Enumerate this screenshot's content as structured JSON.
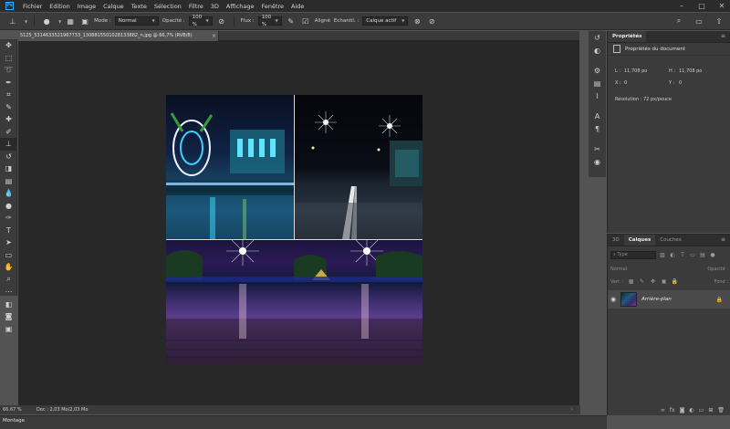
{
  "menubar": {
    "app_icon": "Ps",
    "items": [
      "Fichier",
      "Edition",
      "Image",
      "Calque",
      "Texte",
      "Sélection",
      "Filtre",
      "3D",
      "Affichage",
      "Fenêtre",
      "Aide"
    ]
  },
  "options": {
    "mode_label": "Mode :",
    "mode_value": "Normal",
    "opacity_label": "Opacité :",
    "opacity_value": "100 %",
    "flow_label": "Flux :",
    "flow_value": "100 %",
    "aligned_label": "Aligné",
    "aligned_checked": true,
    "sample_label": "Echantil. :",
    "sample_value": "Calque actif"
  },
  "document": {
    "tab_title": "5125_5314633521967733_1308815501028133882_n.jpg @ 66,7% (RVB/8)",
    "close": "×"
  },
  "status": {
    "zoom": "66.67 %",
    "doc_size": "Doc : 2,03 Mo/2,03 Mo",
    "arrow": "›"
  },
  "bottom": {
    "timeline_label": "Montage"
  },
  "properties": {
    "tab_label": "Propriétés",
    "subhead": "Propriétés du document",
    "width_label": "L :",
    "width_value": "11,708 po",
    "height_label": "H :",
    "height_value": "11,708 po",
    "x_label": "X :",
    "x_value": "0",
    "y_label": "Y :",
    "y_value": "0",
    "resolution": "Résolution : 72 px/pouce"
  },
  "layers": {
    "tabs": [
      "3D",
      "Calques",
      "Couches"
    ],
    "active_tab": "Calques",
    "filter_placeholder": "Type",
    "blend_mode": "Normal",
    "opacity_label": "Opacité :",
    "lock_label": "Verr. :",
    "fill_label": "Fond :",
    "layer_name": "Arrière-plan"
  },
  "colors": {
    "accent": "#31a8ff",
    "panel_bg": "#3b3b3b",
    "canvas_bg": "#282828"
  }
}
